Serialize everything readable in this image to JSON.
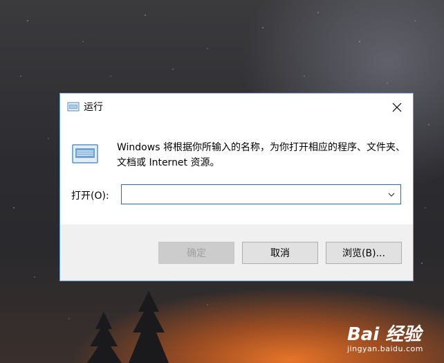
{
  "dialog": {
    "title": "运行",
    "description": "Windows 将根据你所输入的名称，为你打开相应的程序、文件夹、文档或 Internet 资源。",
    "open_label": "打开(O):",
    "open_value": "",
    "buttons": {
      "ok": "确定",
      "cancel": "取消",
      "browse": "浏览(B)..."
    }
  },
  "watermark": {
    "logo": "Bai 经验",
    "url": "jingyan.baidu.com"
  },
  "colors": {
    "dialog_border": "#6aa0d8",
    "input_border": "#1f6fb5",
    "footer_bg": "#f0f0f0"
  },
  "icons": [
    "run-icon",
    "close-icon",
    "chevron-down-icon"
  ]
}
